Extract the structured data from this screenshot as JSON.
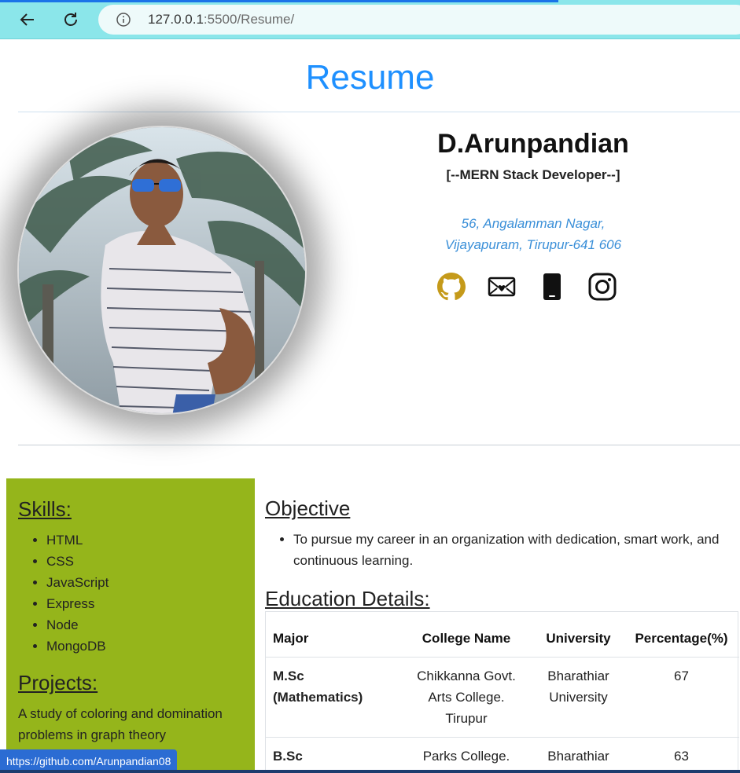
{
  "browser": {
    "url_host": "127.0.0.1",
    "url_rest": ":5500/Resume/",
    "status_link": "https://github.com/Arunpandian08"
  },
  "page": {
    "title": "Resume",
    "name": "D.Arunpandian",
    "role": "[--MERN Stack Developer--]",
    "address_line1": "56, Angalamman Nagar,",
    "address_line2": "Vijayapuram, Tirupur-641 606",
    "socials": [
      "github-icon",
      "email-icon",
      "phone-icon",
      "instagram-icon"
    ]
  },
  "sidebar": {
    "skills_title": "Skills:",
    "skills": [
      "HTML",
      "CSS",
      "JavaScript",
      "Express",
      "Node",
      "MongoDB"
    ],
    "projects_title": "Projects:",
    "project": "A study of coloring and domination problems in graph theory"
  },
  "main": {
    "objective_title": "Objective",
    "objective": "To pursue my career in an organization with dedication, smart work, and continuous learning.",
    "education_title": "Education Details:",
    "table_headers": [
      "Major",
      "College Name",
      "University",
      "Percentage(%)"
    ],
    "rows": [
      [
        "M.Sc (Mathematics)",
        "Chikkanna Govt. Arts College. Tirupur",
        "Bharathiar University",
        "67"
      ],
      [
        "B.Sc (Mathematics)",
        "Parks College. Tirupur",
        "Bharathiar University",
        "63"
      ]
    ]
  },
  "colors": {
    "title": "#1e90ff",
    "sidebar": "#95b51b",
    "address": "#3a8fd8",
    "chrome": "#8be6ea"
  }
}
